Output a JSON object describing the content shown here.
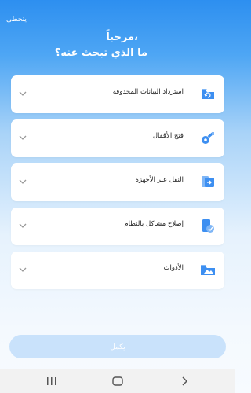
{
  "header": {
    "skip_label": "يتخطى",
    "welcome_line1": "مرحباً،",
    "welcome_line2": "ما الذي تبحث عنه؟"
  },
  "options": [
    {
      "label": "استرداد البيانات المحذوفة",
      "icon": "recycle-folder-icon"
    },
    {
      "label": "فتح الأقفال",
      "icon": "key-icon"
    },
    {
      "label": "النقل عبر الأجهزة",
      "icon": "device-transfer-icon"
    },
    {
      "label": "إصلاح مشاكل بالنظام",
      "icon": "system-repair-icon"
    },
    {
      "label": "الأدوات",
      "icon": "tools-folder-icon"
    }
  ],
  "primary_button": {
    "label": "يكمل"
  },
  "nav": {
    "recents": "recents-icon",
    "home": "home-icon",
    "back": "back-icon"
  },
  "colors": {
    "accent": "#2d8ff0",
    "button_disabled": "#c9e2fb",
    "icon_blue": "#3d8ff1"
  }
}
